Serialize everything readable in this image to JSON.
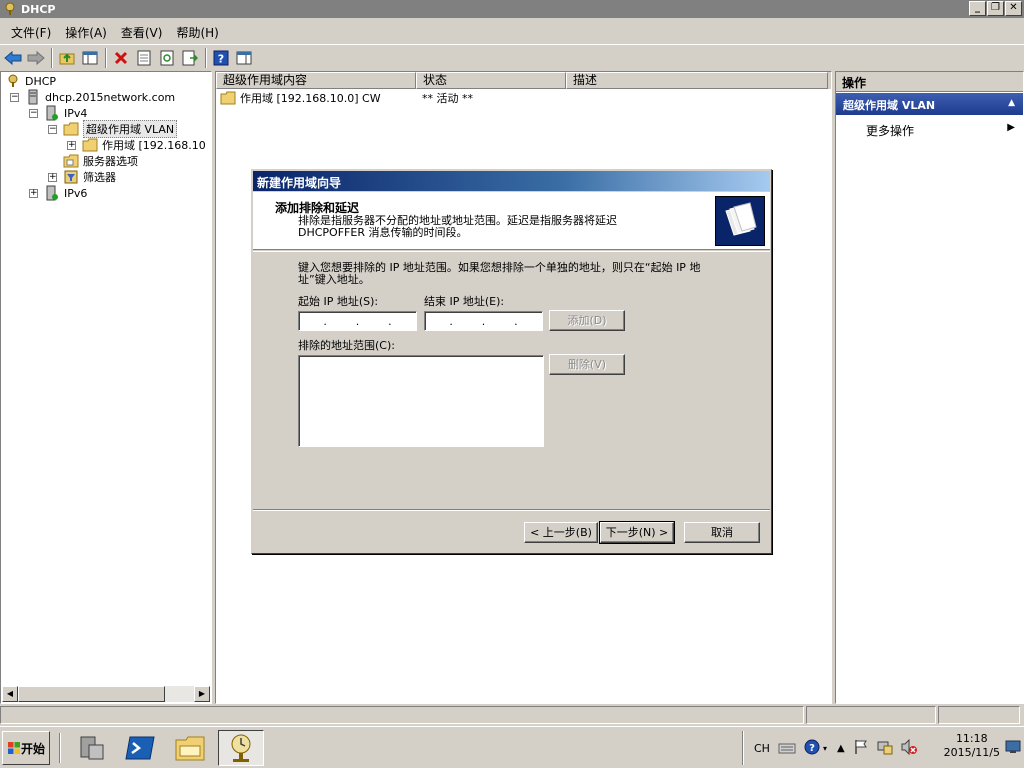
{
  "window": {
    "title": "DHCP",
    "minimize": "_",
    "restore": "❐",
    "close": "✕"
  },
  "menu": [
    "文件(F)",
    "操作(A)",
    "查看(V)",
    "帮助(H)"
  ],
  "tree": {
    "root": "DHCP",
    "server": "dhcp.2015network.com",
    "ipv4": "IPv4",
    "superscope": "超级作用域 VLAN",
    "scope": "作用域 [192.168.10",
    "server_options": "服务器选项",
    "filters": "筛选器",
    "ipv6": "IPv6"
  },
  "list": {
    "columns": [
      "超级作用域内容",
      "状态",
      "描述"
    ],
    "rows": [
      {
        "name": "作用域 [192.168.10.0] CW",
        "status": "** 活动 **",
        "desc": ""
      }
    ]
  },
  "actions": {
    "header": "操作",
    "section": "超级作用域 VLAN",
    "more": "更多操作"
  },
  "dialog": {
    "title": "新建作用域向导",
    "heading": "添加排除和延迟",
    "description": "排除是指服务器不分配的地址或地址范围。延迟是指服务器将延迟 DHCPOFFER 消息传输的时间段。",
    "instruction": "键入您想要排除的 IP 地址范围。如果您想排除一个单独的地址，则只在“起始 IP 地址”键入地址。",
    "start_ip_label": "起始 IP 地址(S):",
    "end_ip_label": "结束 IP 地址(E):",
    "add_button": "添加(D)",
    "excluded_label": "排除的地址范围(C):",
    "remove_button": "删除(V)",
    "back_button": "< 上一步(B)",
    "next_button": "下一步(N) >",
    "cancel_button": "取消"
  },
  "taskbar": {
    "start": "开始",
    "lang": "CH",
    "time": "11:18",
    "date": "2015/11/5"
  }
}
